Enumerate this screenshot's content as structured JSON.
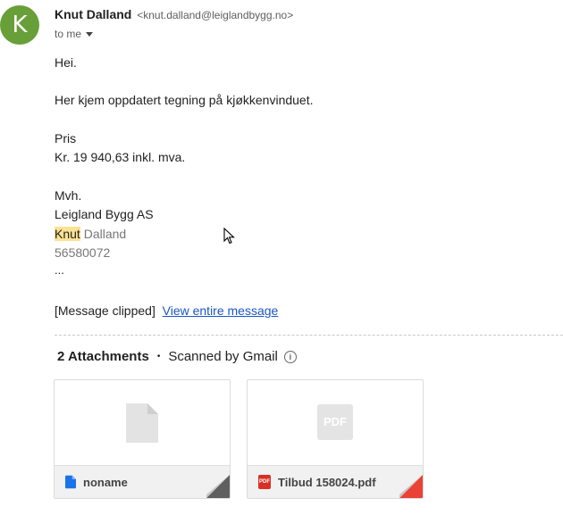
{
  "header": {
    "avatar_letter": "K",
    "sender_name": "Knut Dalland",
    "sender_email": "<knut.dalland@leiglandbygg.no>",
    "to_label": "to me"
  },
  "message": {
    "greeting": "Hei.",
    "line1": "Her kjem oppdatert tegning på kjøkkenvinduet.",
    "price_label": "Pris",
    "price_value": "Kr. 19 940,63 inkl. mva.",
    "signoff": "Mvh.",
    "company": "Leigland Bygg AS",
    "sig_first": "Knut",
    "sig_last": " Dalland",
    "phone": "56580072",
    "ellipsis": "...",
    "clipped_note": "[Message clipped]",
    "view_link": "View entire message"
  },
  "attachments": {
    "count_label": "2 Attachments",
    "separator": "•",
    "scanned_label": "Scanned by Gmail",
    "items": [
      {
        "name": "noname",
        "icon": "document-icon",
        "accent": "#1a73e8"
      },
      {
        "name": "Tilbud 158024.pdf",
        "icon": "pdf-icon",
        "accent": "#ea4335",
        "badge": "PDF"
      }
    ]
  }
}
